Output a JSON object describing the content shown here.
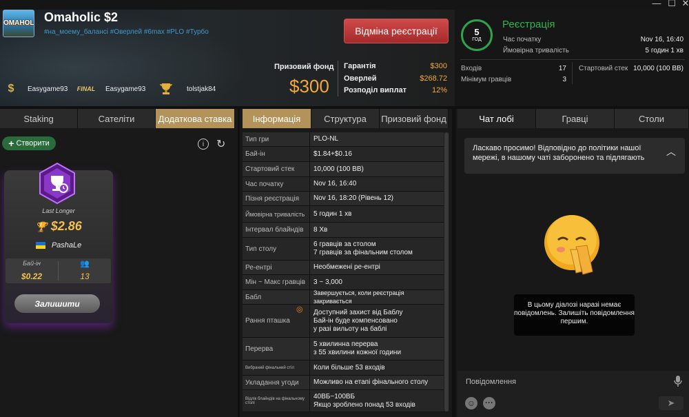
{
  "window": {
    "minimize": "—",
    "maximize": "☐",
    "close": "✕"
  },
  "tournament": {
    "logo": "OMAHOLIC",
    "name": "Omaholic $2",
    "tags": "#на_моему_балансі #Оверлей #6max #PLO #Турбо"
  },
  "winners": [
    {
      "icon": "bounty-icon",
      "name": "Easygame93"
    },
    {
      "icon": "final-icon",
      "icon_text": "FINAL",
      "name": "Easygame93"
    },
    {
      "icon": "trophy-icon",
      "name": "tolstjak84"
    }
  ],
  "cancel_label": "Відміна реєстрації",
  "prize": {
    "label": "Призовий фонд",
    "value": "$300",
    "rows": [
      {
        "k": "Гарантія",
        "v": "$300"
      },
      {
        "k": "Оверлей",
        "v": "$268.72"
      },
      {
        "k": "Розподіл виплат",
        "v": "12%"
      }
    ]
  },
  "registration": {
    "clock_value": "5",
    "clock_unit": "ГОД",
    "title": "Реєстрація",
    "start_lbl": "Час початку",
    "start_val": "Nov 16, 16:40",
    "dur_lbl": "Ймовірна тривалість",
    "dur_val": "5 годин 1 хв"
  },
  "entries": {
    "entries_lbl": "Входів",
    "entries_val": "17",
    "min_lbl": "Мінімум гравців",
    "min_val": "3",
    "stack_lbl": "Стартовий стек",
    "stack_val": "10,000 (100 BB)"
  },
  "left_tabs": [
    "Staking",
    "Сателіти",
    "Додаткова ставка"
  ],
  "mid_tabs": [
    "Інформація",
    "Структура",
    "Призовий фонд"
  ],
  "right_tabs": [
    "Чат лобі",
    "Гравці",
    "Столи"
  ],
  "create_label": "Створити",
  "card": {
    "type": "Last Longer",
    "amount": "$2.86",
    "player": "PashaLe",
    "buyin_lbl": "Бай-ін",
    "buyin_val": "$0.22",
    "players_val": "13",
    "keep_label": "Залишити"
  },
  "info": [
    {
      "k": "Тип гри",
      "v": [
        "PLO-NL"
      ]
    },
    {
      "k": "Бай-ін",
      "v": [
        "$1.84+$0.16"
      ]
    },
    {
      "k": "Стартовий стек",
      "v": [
        "10,000 (100 BB)"
      ]
    },
    {
      "k": "Час початку",
      "v": [
        "Nov 16, 16:40"
      ]
    },
    {
      "k": "Пізня реєстрація",
      "v": [
        "Nov 16, 18:20 (Рівень 12)"
      ]
    },
    {
      "k": "Ймовірна тривалість",
      "v": [
        "5 годин 1 хв"
      ]
    },
    {
      "k": "Інтервал блайндів",
      "v": [
        "8 Хв"
      ]
    },
    {
      "k": "Тип столу",
      "v": [
        "6 гравців за столом",
        "7 гравців за фінальним столом"
      ]
    },
    {
      "k": "Ре-ентрі",
      "v": [
        "Необмежені ре-ентрі"
      ]
    },
    {
      "k": "Мін ~ Макс гравців",
      "v": [
        "3 ~ 3,000"
      ]
    },
    {
      "k": "Бабл",
      "v": [
        "Завершується, коли реєстрація закривається"
      ]
    },
    {
      "k": "Рання пташка",
      "v": [
        "Доступний захист від Баблу",
        "Бай-ін буде компенсовано",
        "у разі вильоту на баблі"
      ]
    },
    {
      "k": "Перерва",
      "v": [
        "5 хвилинна перерва",
        "з 55 хвилини кожної години"
      ]
    },
    {
      "k": "Вибраний фінальний стіл",
      "v": [
        "Коли більше 53 входів"
      ]
    },
    {
      "k": "Укладання угоди",
      "v": [
        "Можливо на етапі фінального столу"
      ]
    },
    {
      "k": "Відлік блайндів на фінальному столі",
      "v": [
        "40ВБ~100ВБ",
        "Якщо зроблено понад 53 входів"
      ]
    }
  ],
  "chat": {
    "welcome": "Ласкаво просимо! Відповідно до політики нашої мережі, в нашому чаті заборонено та підлягають",
    "empty": "В цьому діалозі наразі немає повідомлень. Залишіть повідомлення першим.",
    "placeholder": "Повідомлення"
  },
  "colors": {
    "accent_gold": "#b3935a",
    "green": "#2fb551",
    "cancel_red": "#b33333",
    "prize_orange": "#f2a93b"
  }
}
